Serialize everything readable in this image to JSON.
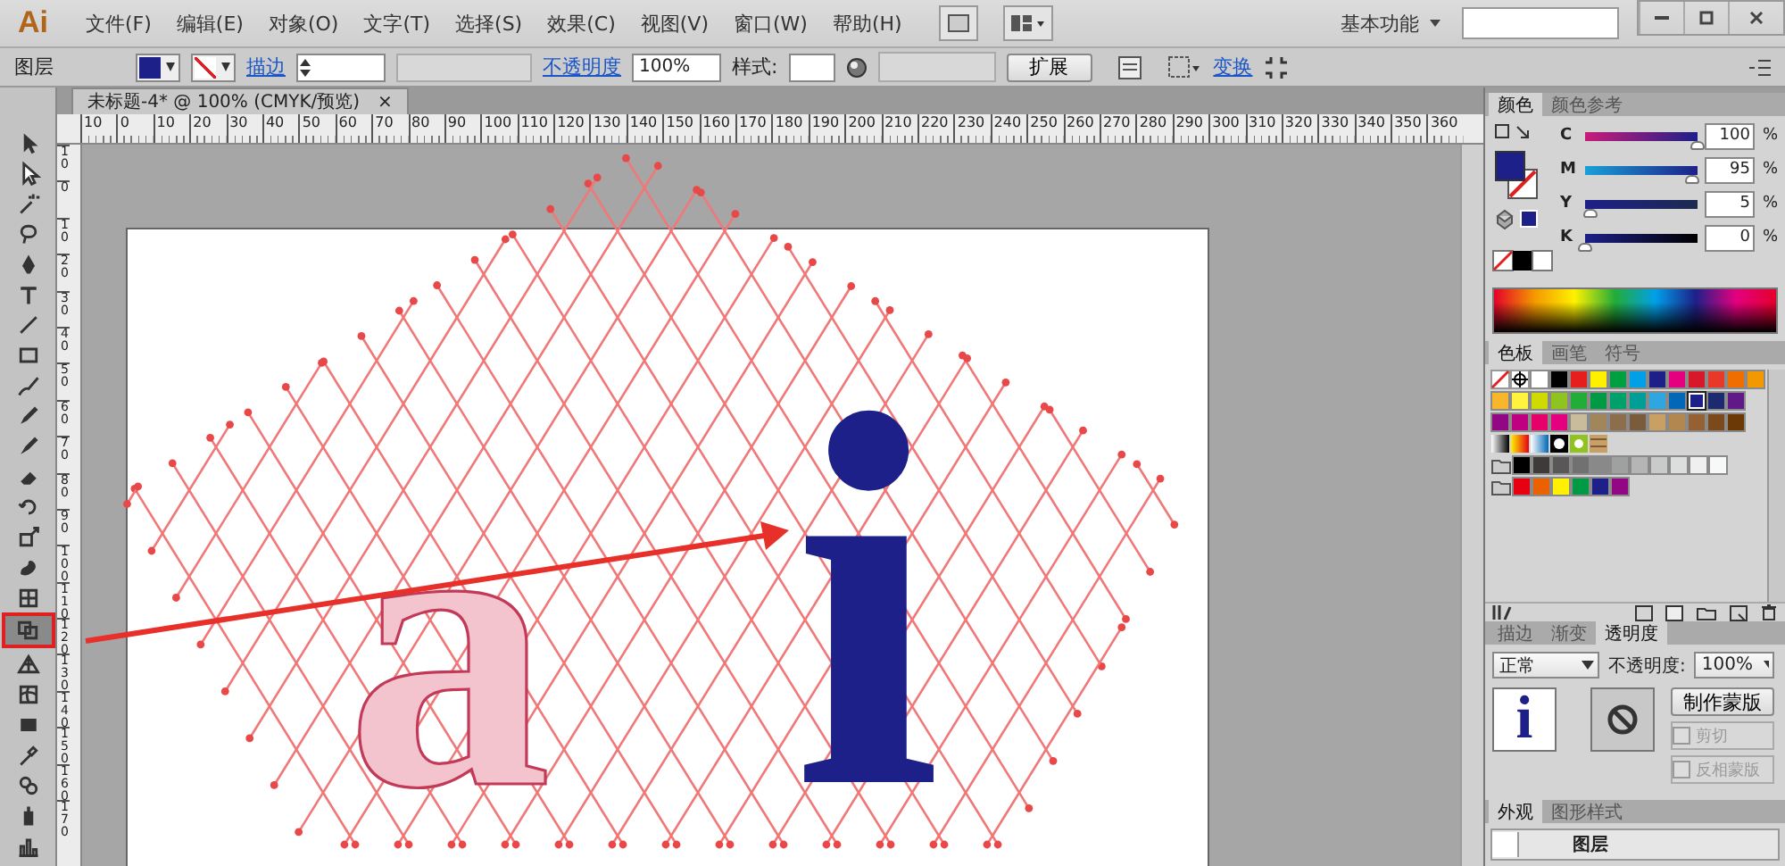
{
  "menu_bar": {
    "logo": "Ai",
    "menus": [
      "文件(F)",
      "编辑(E)",
      "对象(O)",
      "文字(T)",
      "选择(S)",
      "效果(C)",
      "视图(V)",
      "窗口(W)",
      "帮助(H)"
    ],
    "workspace": "基本功能"
  },
  "control_bar": {
    "selection_label": "图层",
    "stroke_link": "描边",
    "opacity_link": "不透明度",
    "opacity_value": "100%",
    "style_label": "样式:",
    "expand_button": "扩展",
    "transform_link": "变换"
  },
  "document": {
    "tab_title": "未标题-4* @ 100% (CMYK/预览)",
    "close_glyph": "×"
  },
  "rulers": {
    "horizontal": [
      "10",
      "0",
      "10",
      "20",
      "30",
      "40",
      "50",
      "60",
      "70",
      "80",
      "90",
      "100",
      "110",
      "120",
      "130",
      "140",
      "150",
      "160",
      "170",
      "180",
      "190",
      "200",
      "210",
      "220",
      "230",
      "240",
      "250",
      "260",
      "270",
      "280",
      "290",
      "300",
      "310",
      "320",
      "330",
      "340",
      "350",
      "360"
    ],
    "vertical": [
      "10",
      "0",
      "10",
      "20",
      "30",
      "40",
      "50",
      "60",
      "70",
      "80",
      "90",
      "100",
      "110",
      "120",
      "130",
      "140",
      "150",
      "160",
      "170"
    ]
  },
  "tools": [
    {
      "selected": false
    },
    {
      "selected": false
    },
    {
      "selected": false
    },
    {
      "selected": false
    },
    {
      "selected": false
    },
    {
      "selected": false
    },
    {
      "selected": false
    },
    {
      "selected": false
    },
    {
      "selected": false
    },
    {
      "selected": false
    },
    {
      "selected": false
    },
    {
      "selected": false
    },
    {
      "selected": false
    },
    {
      "selected": false
    },
    {
      "selected": false
    },
    {
      "selected": false
    },
    {
      "selected": true
    },
    {
      "selected": false
    },
    {
      "selected": false
    },
    {
      "selected": false
    },
    {
      "selected": false
    },
    {
      "selected": false
    },
    {
      "selected": false
    },
    {
      "selected": false
    }
  ],
  "artwork": {
    "outlined_letter": "a",
    "filled_letter": "i"
  },
  "color_panel": {
    "tabs": [
      {
        "label": "颜色",
        "selected": true
      },
      {
        "label": "颜色参考",
        "selected": false
      }
    ],
    "channels": [
      {
        "name": "C",
        "value": "100",
        "unit": "%",
        "level": 1.0
      },
      {
        "name": "M",
        "value": "95",
        "unit": "%",
        "level": 0.95
      },
      {
        "name": "Y",
        "value": "5",
        "unit": "%",
        "level": 0.05
      },
      {
        "name": "K",
        "value": "0",
        "unit": "%",
        "level": 0.0
      }
    ]
  },
  "swatches_panel": {
    "tabs": [
      {
        "label": "色板",
        "selected": true
      },
      {
        "label": "画笔",
        "selected": false
      },
      {
        "label": "符号",
        "selected": false
      }
    ],
    "rows": [
      {
        "kind": "plain",
        "swatches": [
          {
            "color": "#ffffff",
            "selected": false
          },
          {
            "color": "#000000",
            "selected": false
          },
          {
            "color": "#e61e1e",
            "selected": false
          },
          {
            "color": "#fff000",
            "selected": false
          },
          {
            "color": "#00a040",
            "selected": false
          },
          {
            "color": "#00a0e9",
            "selected": false
          },
          {
            "color": "#1d2088",
            "selected": false
          },
          {
            "color": "#e4007f",
            "selected": false
          },
          {
            "color": "#d7182a",
            "selected": false
          },
          {
            "color": "#e8382a",
            "selected": false
          },
          {
            "color": "#f06d00",
            "selected": false
          },
          {
            "color": "#f39800",
            "selected": false
          }
        ]
      },
      {
        "kind": "plain",
        "swatches": [
          {
            "color": "#f8b62d",
            "selected": false
          },
          {
            "color": "#fff33f",
            "selected": false
          },
          {
            "color": "#cfdb00",
            "selected": false
          },
          {
            "color": "#8fc31f",
            "selected": false
          },
          {
            "color": "#22ac38",
            "selected": false
          },
          {
            "color": "#009944",
            "selected": false
          },
          {
            "color": "#00a06a",
            "selected": false
          },
          {
            "color": "#009e96",
            "selected": false
          },
          {
            "color": "#2ea7e0",
            "selected": false
          },
          {
            "color": "#0068b7",
            "selected": false
          },
          {
            "color": "#1d2088",
            "selected": true
          },
          {
            "color": "#1d2a70",
            "selected": false
          },
          {
            "color": "#601986",
            "selected": false
          }
        ]
      },
      {
        "kind": "plain",
        "swatches": [
          {
            "color": "#920783",
            "selected": false
          },
          {
            "color": "#be0081",
            "selected": false
          },
          {
            "color": "#e5006a",
            "selected": false
          },
          {
            "color": "#e4007f",
            "selected": false
          },
          {
            "color": "#c9bc9c",
            "selected": false
          },
          {
            "color": "#a0865a",
            "selected": false
          },
          {
            "color": "#8c6e4d",
            "selected": false
          },
          {
            "color": "#7a5c3c",
            "selected": false
          },
          {
            "color": "#c8a063",
            "selected": false
          },
          {
            "color": "#b28850",
            "selected": false
          },
          {
            "color": "#956134",
            "selected": false
          },
          {
            "color": "#7c4a1a",
            "selected": false
          },
          {
            "color": "#6a3906",
            "selected": false
          }
        ]
      },
      {
        "kind": "pattern",
        "swatches": []
      },
      {
        "kind": "group",
        "swatches": [
          {
            "color": "#000000",
            "selected": false
          },
          {
            "color": "#3e3a39",
            "selected": false
          },
          {
            "color": "#595757",
            "selected": false
          },
          {
            "color": "#727171",
            "selected": false
          },
          {
            "color": "#898989",
            "selected": false
          },
          {
            "color": "#9fa0a0",
            "selected": false
          },
          {
            "color": "#b5b5b6",
            "selected": false
          },
          {
            "color": "#c9caca",
            "selected": false
          },
          {
            "color": "#dcdddd",
            "selected": false
          },
          {
            "color": "#efefef",
            "selected": false
          },
          {
            "color": "#f7f8f8",
            "selected": false
          }
        ]
      },
      {
        "kind": "group",
        "swatches": [
          {
            "color": "#e60012",
            "selected": false
          },
          {
            "color": "#eb6100",
            "selected": false
          },
          {
            "color": "#fff100",
            "selected": false
          },
          {
            "color": "#009944",
            "selected": false
          },
          {
            "color": "#1d2088",
            "selected": false
          },
          {
            "color": "#920783",
            "selected": false
          }
        ]
      }
    ]
  },
  "transparency_panel": {
    "tabs": [
      {
        "label": "描边",
        "selected": false
      },
      {
        "label": "渐变",
        "selected": false
      },
      {
        "label": "透明度",
        "selected": true
      }
    ],
    "blend_mode": "正常",
    "opacity_label": "不透明度:",
    "opacity_value": "100%",
    "thumbnail_letter": "i",
    "make_mask_button": "制作蒙版",
    "options": [
      {
        "label": "剪切",
        "checked": false,
        "disabled": true
      },
      {
        "label": "反相蒙版",
        "checked": false,
        "disabled": true
      }
    ]
  },
  "appearance_panel": {
    "tabs": [
      {
        "label": "外观",
        "selected": true
      },
      {
        "label": "图形样式",
        "selected": false
      }
    ],
    "row_label": "图层"
  }
}
